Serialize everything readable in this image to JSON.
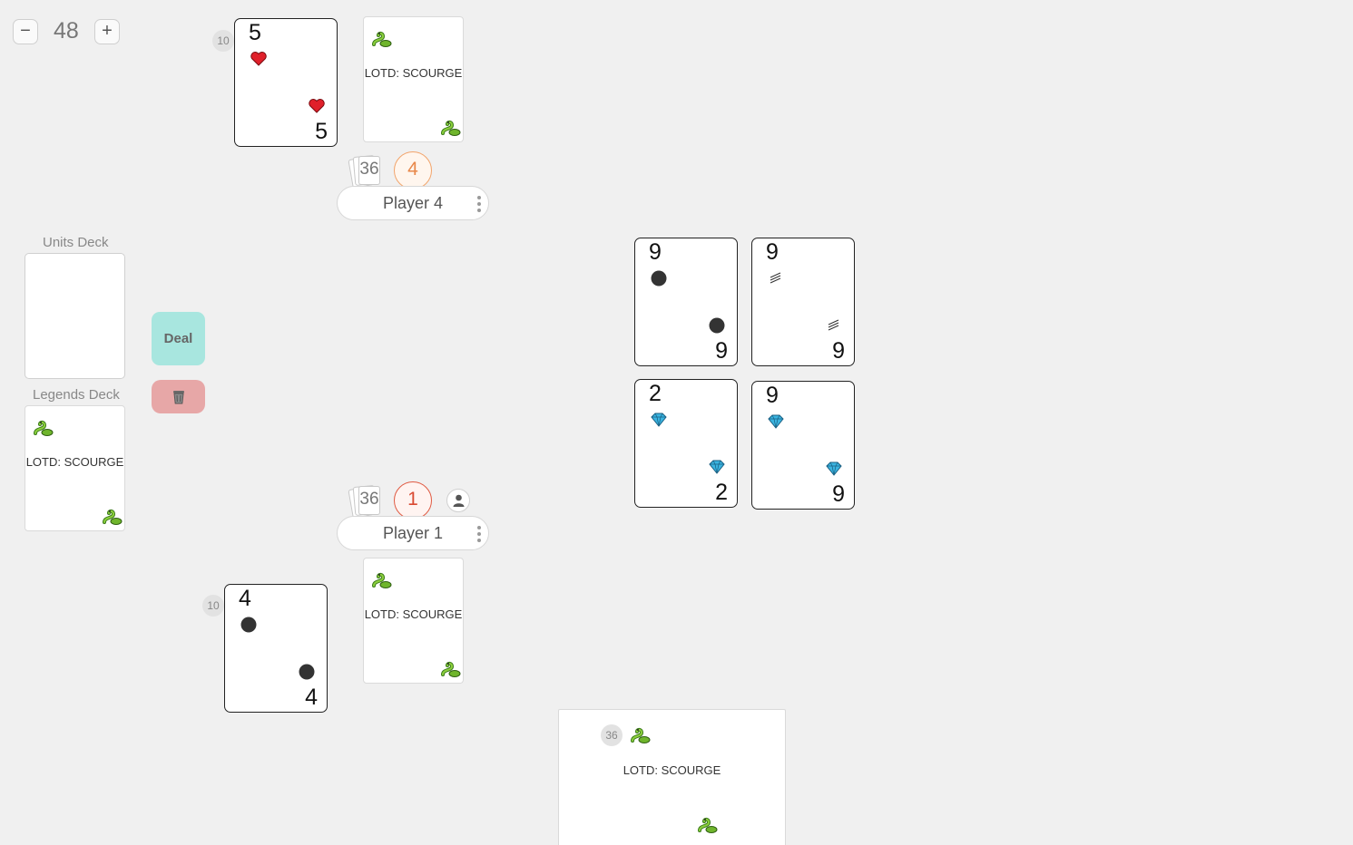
{
  "zoom": {
    "minus": "−",
    "value": "48",
    "plus": "+"
  },
  "decks": {
    "units_label": "Units Deck",
    "legends_label": "Legends Deck",
    "legends_top_card": "LOTD: SCOURGE"
  },
  "actions": {
    "deal_label": "Deal",
    "trash_icon": "trash-icon"
  },
  "players": [
    {
      "name": "Player 4",
      "number": "4",
      "deck_count": "36",
      "ring_color": "#f2a46b",
      "hand_count": "10",
      "unit_card": {
        "rank": "5",
        "suit": "hearts"
      },
      "legend_card": "LOTD: SCOURGE"
    },
    {
      "name": "Player 1",
      "number": "1",
      "deck_count": "36",
      "ring_color": "#e05a42",
      "hand_count": "10",
      "unit_card": {
        "rank": "4",
        "suit": "dot"
      },
      "legend_card": "LOTD: SCOURGE"
    }
  ],
  "board": [
    {
      "rank": "9",
      "suit": "dot"
    },
    {
      "rank": "9",
      "suit": "stripes"
    },
    {
      "rank": "2",
      "suit": "diamond"
    },
    {
      "rank": "9",
      "suit": "diamond"
    }
  ],
  "preview": {
    "count": "36",
    "title": "LOTD: SCOURGE"
  },
  "colors": {
    "heart": "#e0202a",
    "diamond": "#3ab4e0",
    "dot": "#333333",
    "background": "#f0f0f0"
  }
}
